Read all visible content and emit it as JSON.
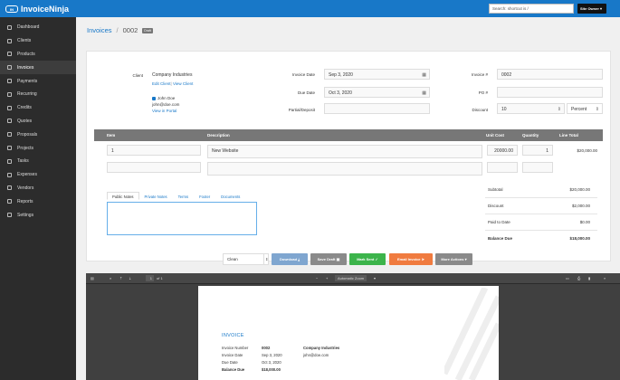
{
  "app": {
    "name": "InvoiceNinja",
    "logo_mark": "IN"
  },
  "search": {
    "placeholder": "Search: shortcut is /"
  },
  "user_menu": {
    "label": "Site Owner"
  },
  "sidebar": {
    "items": [
      {
        "label": "Dashboard",
        "icon": "tachometer-icon"
      },
      {
        "label": "Clients",
        "icon": "users-icon"
      },
      {
        "label": "Products",
        "icon": "cube-icon"
      },
      {
        "label": "Invoices",
        "icon": "file-icon",
        "active": true
      },
      {
        "label": "Payments",
        "icon": "credit-card-icon"
      },
      {
        "label": "Recurring",
        "icon": "refresh-icon"
      },
      {
        "label": "Credits",
        "icon": "credit-icon"
      },
      {
        "label": "Quotes",
        "icon": "quote-icon"
      },
      {
        "label": "Proposals",
        "icon": "proposal-icon"
      },
      {
        "label": "Projects",
        "icon": "briefcase-icon"
      },
      {
        "label": "Tasks",
        "icon": "clock-icon"
      },
      {
        "label": "Expenses",
        "icon": "expense-icon"
      },
      {
        "label": "Vendors",
        "icon": "building-icon"
      },
      {
        "label": "Reports",
        "icon": "chart-icon"
      },
      {
        "label": "Settings",
        "icon": "gear-icon"
      }
    ]
  },
  "breadcrumb": {
    "parent": "Invoices",
    "separator": "/",
    "current": "0002",
    "badge": "Draft"
  },
  "form": {
    "client_label": "Client",
    "client_name": "Company Industries",
    "edit_client": "Edit Client",
    "view_client": "View Client",
    "contact_name": "John Doe",
    "contact_email": "john@doe.com",
    "view_portal": "View in Portal",
    "invoice_date_label": "Invoice Date",
    "invoice_date": "Sep 3, 2020",
    "due_date_label": "Due Date",
    "due_date": "Oct 3, 2020",
    "partial_label": "Partial/Deposit",
    "partial_value": "",
    "invoice_num_label": "Invoice #",
    "invoice_num": "0002",
    "po_label": "PO #",
    "po_value": "",
    "discount_label": "Discount",
    "discount_value": "10",
    "discount_type": "Percent"
  },
  "items_table": {
    "headers": {
      "item": "Item",
      "description": "Description",
      "unit_cost": "Unit Cost",
      "quantity": "Quantity",
      "line_total": "Line Total"
    },
    "rows": [
      {
        "item": "1",
        "description": "New Website",
        "unit_cost": "20000.00",
        "quantity": "1",
        "line_total": "$20,000.00"
      }
    ]
  },
  "note_tabs": [
    "Public Notes",
    "Private Notes",
    "Terms",
    "Footer",
    "Documents"
  ],
  "totals": {
    "subtotal_label": "Subtotal",
    "subtotal": "$20,000.00",
    "discount_label": "Discount",
    "discount": "$2,000.00",
    "paid_label": "Paid to Date",
    "paid": "$0.00",
    "balance_label": "Balance Due",
    "balance": "$18,000.00"
  },
  "actions": {
    "design": "Clean",
    "download": "Download",
    "save_draft": "Save Draft",
    "mark_sent": "Mark Sent",
    "email": "Email Invoice",
    "more": "More Actions",
    "colors": {
      "download": "#7fa6d0",
      "save": "#8a8a8a",
      "mark_sent": "#3cb44b",
      "email": "#f07b3f",
      "more": "#8a8a8a"
    }
  },
  "viewer": {
    "page_num": "1",
    "page_of": "of 1",
    "zoom": "Automatic Zoom",
    "pdf": {
      "title": "INVOICE",
      "invoice_number_label": "Invoice Number",
      "invoice_number": "0002",
      "invoice_date_label": "Invoice Date",
      "invoice_date": "Sep 3, 2020",
      "due_date_label": "Due Date",
      "due_date": "Oct 3, 2020",
      "balance_due_label": "Balance Due",
      "balance_due": "$18,000.00",
      "client_name": "Company Industries",
      "client_email": "john@doe.com"
    }
  }
}
